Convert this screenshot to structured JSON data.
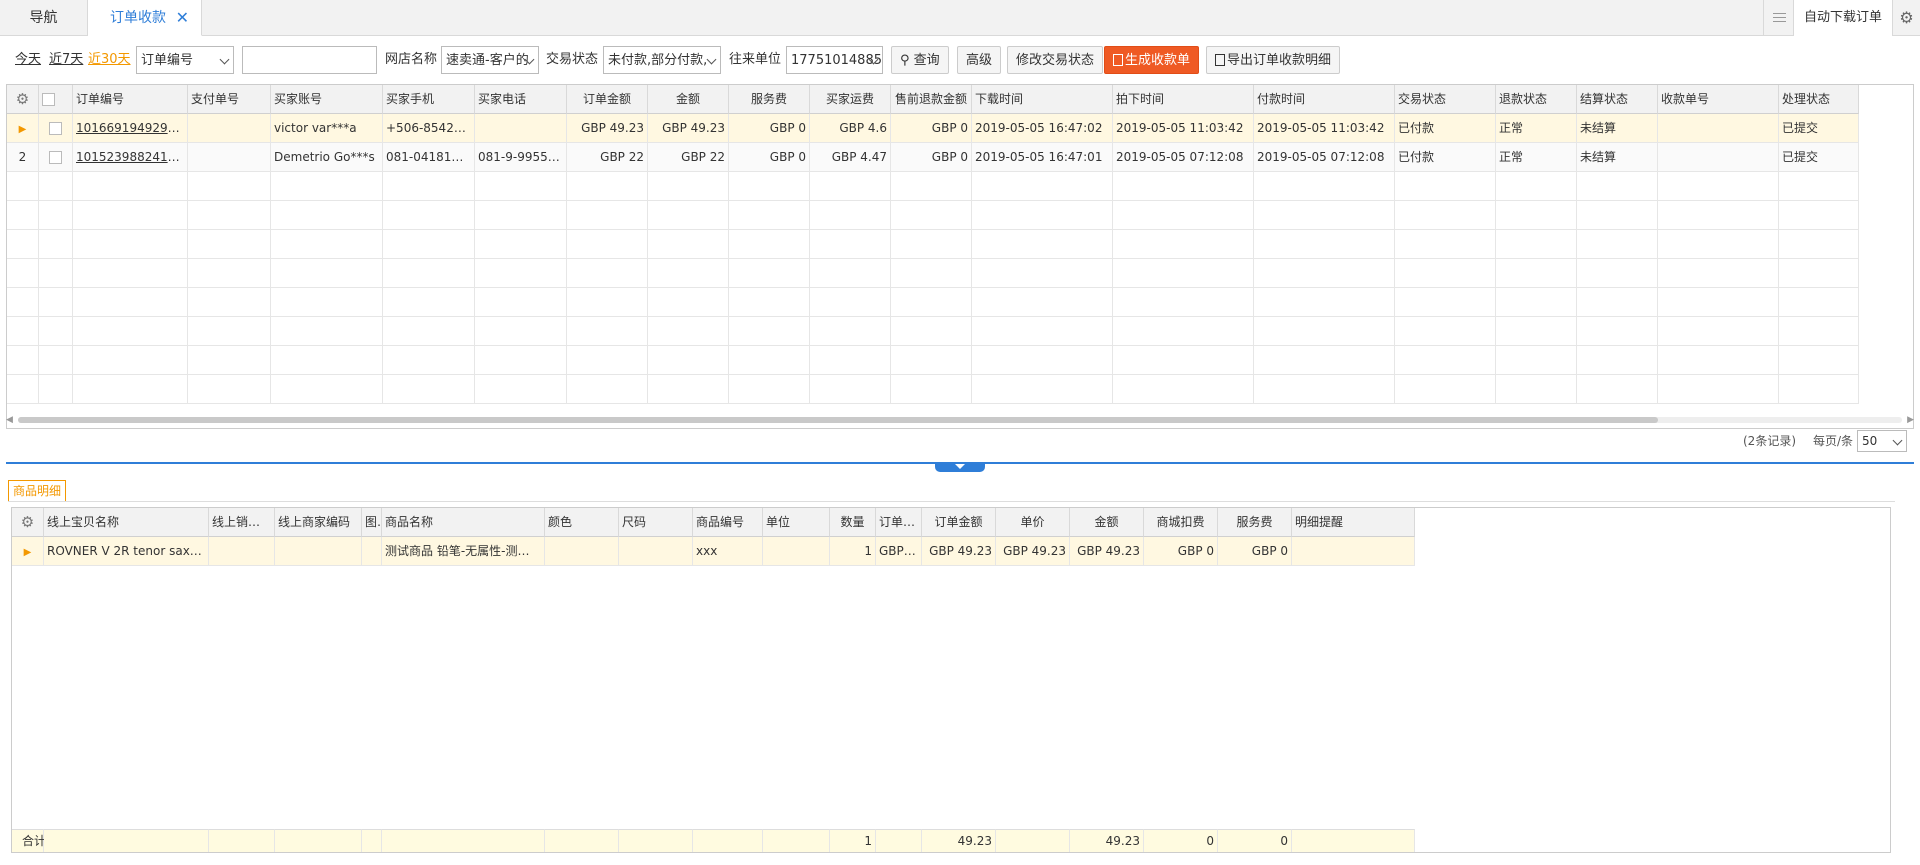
{
  "tabs": {
    "nav": "导航",
    "active": "订单收款",
    "close": "✕"
  },
  "topbar": {
    "auto_download": "自动下载订单",
    "gear": "⚙"
  },
  "filters": {
    "today": "今天",
    "last7": "近7天",
    "last30": "近30天",
    "field_select": "订单编号",
    "search_value": "",
    "shop_label": "网店名称",
    "shop_value": "速卖通-客户的",
    "trade_status_label": "交易状态",
    "trade_status_value": "未付款,部分付款,",
    "partner_label": "往来单位",
    "partner_value": "17751014885",
    "query_btn": "查询",
    "advanced_btn": "高级",
    "modify_status_btn": "修改交易状态",
    "generate_btn": "生成收款单",
    "export_btn": "导出订单收款明细"
  },
  "orders": {
    "headers": [
      "⚙",
      "",
      "订单编号",
      "支付单号",
      "买家账号",
      "买家手机",
      "买家电话",
      "订单金额",
      "金额",
      "服务费",
      "买家运费",
      "售前退款金额",
      "下载时间",
      "拍下时间",
      "付款时间",
      "交易状态",
      "退款状态",
      "结算状态",
      "收款单号",
      "处理状态"
    ],
    "rows": [
      {
        "idx": "▶",
        "order_no": "101669194929692",
        "pay_no": "",
        "buyer_account": "victor var***a",
        "mobile": "+506-8542****...",
        "phone": "",
        "order_amount": "GBP 49.23",
        "amount": "GBP 49.23",
        "service_fee": "GBP 0",
        "shipping": "GBP 4.6",
        "presale_refund": "GBP 0",
        "download_time": "2019-05-05 16:47:02",
        "order_time": "2019-05-05 11:03:42",
        "pay_time": "2019-05-05 11:03:42",
        "trade_status": "已付款",
        "refund_status": "正常",
        "settle_status": "未结算",
        "receipt_no": "",
        "process_status": "已提交"
      },
      {
        "idx": "2",
        "order_no": "101523988241713",
        "pay_no": "",
        "buyer_account": "Demetrio Go***s",
        "mobile": "081-0418199...",
        "phone": "081-9-9955*...",
        "order_amount": "GBP 22",
        "amount": "GBP 22",
        "service_fee": "GBP 0",
        "shipping": "GBP 4.47",
        "presale_refund": "GBP 0",
        "download_time": "2019-05-05 16:47:01",
        "order_time": "2019-05-05 07:12:08",
        "pay_time": "2019-05-05 07:12:08",
        "trade_status": "已付款",
        "refund_status": "正常",
        "settle_status": "未结算",
        "receipt_no": "",
        "process_status": "已提交"
      }
    ]
  },
  "pager": {
    "records": "(2条记录)",
    "per_page_label": "每页/条",
    "per_page_value": "50"
  },
  "detail": {
    "tab_label": "商品明细",
    "headers": [
      "⚙",
      "线上宝贝名称",
      "线上销售属性",
      "线上商家编码",
      "图片",
      "商品名称",
      "颜色",
      "尺码",
      "商品编号",
      "单位",
      "数量",
      "订单单价",
      "订单金额",
      "单价",
      "金额",
      "商城扣费",
      "服务费",
      "明细提醒"
    ],
    "rows": [
      {
        "idx": "▶",
        "online_name": "ROVNER V 2R tenor sax  Hard ru...",
        "online_attr": "",
        "merchant_code": "",
        "image": "",
        "product_name": "测试商品 铅笔-无属性-测试商品勿...",
        "color": "",
        "size": "",
        "product_no": "xxx",
        "unit": "",
        "qty": "1",
        "order_unit_price": "GBP 4...",
        "order_amount": "GBP 49.23",
        "unit_price": "GBP 49.23",
        "amount": "GBP 49.23",
        "mall_fee": "GBP 0",
        "service_fee": "GBP 0",
        "reminder": ""
      }
    ],
    "totals": {
      "label": "合计",
      "qty": "1",
      "order_amount": "49.23",
      "amount": "49.23",
      "mall_fee": "0",
      "service_fee": "0"
    }
  },
  "colors": {
    "accent": "#2f7ed8",
    "primary_button": "#ef5a24",
    "highlight": "#f39800"
  }
}
